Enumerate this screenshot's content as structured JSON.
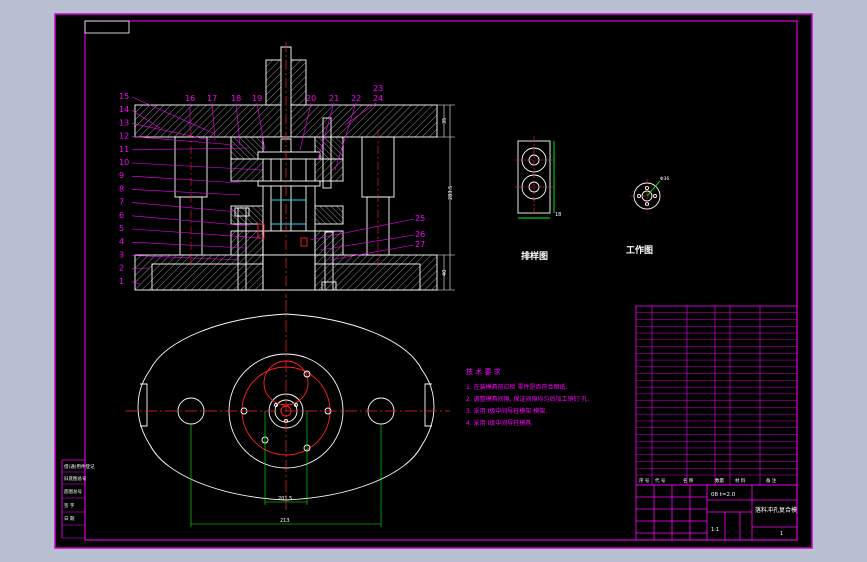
{
  "colors": {
    "background": "#000000",
    "frame_outer": "#b8bfd0",
    "border": "#d200d2",
    "line": "#ffffff",
    "center_line": "#ff2020",
    "dimension": "#00ff00",
    "hatch": "#c8c8c8",
    "leader": "#ff00ff",
    "label": "#ff00ff"
  },
  "section_view": {
    "part_numbers_left": [
      "15",
      "14",
      "13",
      "12",
      "11",
      "10",
      "9",
      "8",
      "7",
      "6",
      "5",
      "4",
      "3",
      "2",
      "1"
    ],
    "part_numbers_top": [
      "16",
      "17",
      "18",
      "19",
      "20",
      "21",
      "22"
    ],
    "part_numbers_right_top": [
      "23",
      "24"
    ],
    "part_numbers_right": [
      "25",
      "26",
      "27"
    ],
    "dim_height": "283.5",
    "dim_top": "35",
    "dim_bottom": "40"
  },
  "strip_layout": {
    "title": "排样图",
    "dim_label": "18"
  },
  "workpiece": {
    "title": "工作图",
    "dim_label": "Φ36"
  },
  "plan_view": {
    "dim_inner": "201.5",
    "dim_outer": "213"
  },
  "tech_notes": {
    "heading": "技 术 要 求",
    "items": [
      "1. 在装模具前应检 零件是否符合图纸.",
      "2. 调整模具间隙, 保证间隙均匀后加工销钉 孔.",
      "3. 采用 Ⅰ级中间导柱模架 模架.",
      "4. 采用 Ⅰ级中间导柱模具."
    ]
  },
  "title_block": {
    "material_label": "08 t=2.0",
    "drawing_name": "落料冲孔复合模",
    "scale": "1:1",
    "sheet": "1",
    "bom_header": [
      "序 号",
      "代 号",
      "名 称",
      "数量",
      "材 料",
      "备 注"
    ]
  },
  "left_stamp": {
    "cells": [
      "借(通)用件登记",
      "旧底图总号",
      "底图总号",
      "签 字",
      "日 期"
    ]
  }
}
